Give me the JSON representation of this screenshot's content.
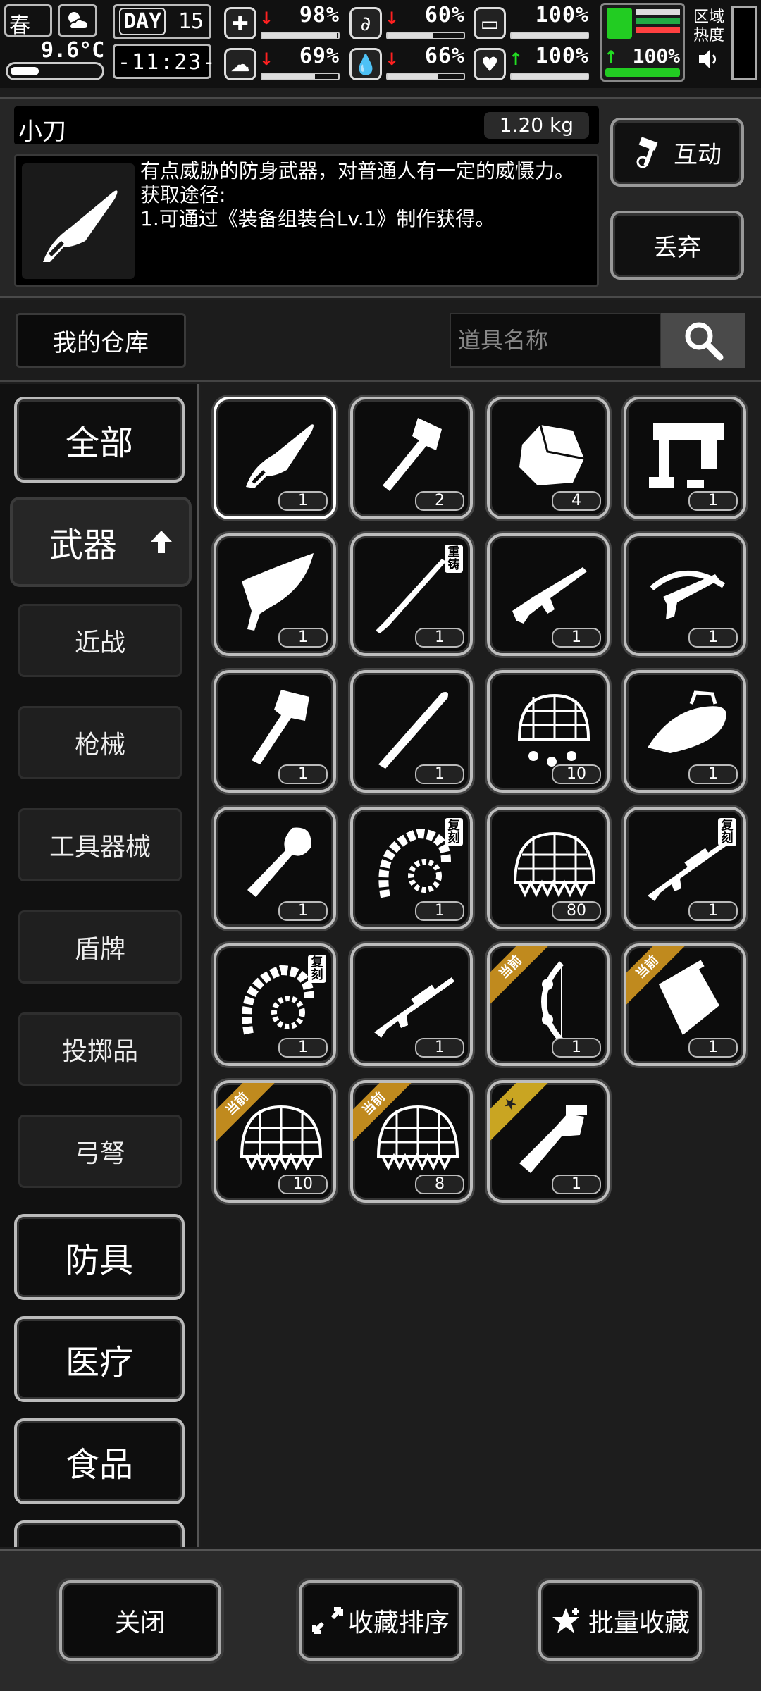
{
  "status": {
    "season": "春",
    "temperature": "9.6°C",
    "day_label": "DAY",
    "day_number": "15",
    "clock": "-11:23-",
    "stats": [
      {
        "icon": "medkit-icon",
        "trend": "down",
        "value": "98%",
        "level": 0.98
      },
      {
        "icon": "stomach-icon",
        "trend": "down",
        "value": "60%",
        "level": 0.6
      },
      {
        "icon": "bladder-icon",
        "trend": "none",
        "value": "100%",
        "level": 1.0
      },
      {
        "icon": "brain-icon",
        "trend": "down",
        "value": "69%",
        "level": 0.69
      },
      {
        "icon": "water-drop-icon",
        "trend": "down",
        "value": "66%",
        "level": 0.66
      },
      {
        "icon": "heart-icon",
        "trend": "up",
        "value": "100%",
        "level": 1.0
      }
    ],
    "stamina_value": "100%",
    "area_heat_label": "区域热度",
    "colors": {
      "up": "#22dd22",
      "down": "#ff2020",
      "stamina": "#22cc22"
    }
  },
  "detail": {
    "name": "小刀",
    "weight": "1.20 kg",
    "description": "有点威胁的防身武器，对普通人有一定的威慑力。\n获取途径:\n1.可通过《装备组装台Lv.1》制作获得。",
    "interact_label": "互动",
    "discard_label": "丢弃"
  },
  "warehouse": {
    "title": "我的仓库",
    "search_placeholder": "道具名称"
  },
  "categories": {
    "all": "全部",
    "weapons": "武器",
    "subs": [
      "近战",
      "枪械",
      "工具器械",
      "盾牌",
      "投掷品",
      "弓弩"
    ],
    "armor": "防具",
    "medical": "医疗",
    "food": "食品"
  },
  "items": [
    {
      "icon": "knife-icon",
      "count": "1"
    },
    {
      "icon": "axe-icon",
      "count": "2"
    },
    {
      "icon": "stone-icon",
      "count": "4"
    },
    {
      "icon": "nail-gun-icon",
      "count": "1"
    },
    {
      "icon": "machete-icon",
      "count": "1"
    },
    {
      "icon": "sword-icon",
      "count": "1",
      "tag": "重铸"
    },
    {
      "icon": "rifle-icon",
      "count": "1"
    },
    {
      "icon": "crossbow-icon",
      "count": "1"
    },
    {
      "icon": "hatchet-icon",
      "count": "1"
    },
    {
      "icon": "stick-icon",
      "count": "1"
    },
    {
      "icon": "net-helmet-icon",
      "count": "10"
    },
    {
      "icon": "disc-icon",
      "count": "1"
    },
    {
      "icon": "shovel-icon",
      "count": "1"
    },
    {
      "icon": "bone-whip-icon",
      "count": "1",
      "tag": "复刻"
    },
    {
      "icon": "spiked-net-icon",
      "count": "80"
    },
    {
      "icon": "sniper-rifle-icon",
      "count": "1",
      "tag": "复刻"
    },
    {
      "icon": "bone-whip-icon",
      "count": "1",
      "tag": "复刻"
    },
    {
      "icon": "sniper-rifle-icon",
      "count": "1"
    },
    {
      "icon": "compound-bow-icon",
      "count": "1",
      "ribbon": "当前"
    },
    {
      "icon": "shield-case-icon",
      "count": "1",
      "ribbon": "当前"
    },
    {
      "icon": "spiked-net-icon",
      "count": "10",
      "ribbon": "当前"
    },
    {
      "icon": "spiked-net-icon",
      "count": "8",
      "ribbon": "当前"
    },
    {
      "icon": "axe-knife-icon",
      "count": "1",
      "ribbon": "★"
    }
  ],
  "bottom": {
    "close": "关闭",
    "sort": "收藏排序",
    "batch_fav": "批量收藏"
  }
}
